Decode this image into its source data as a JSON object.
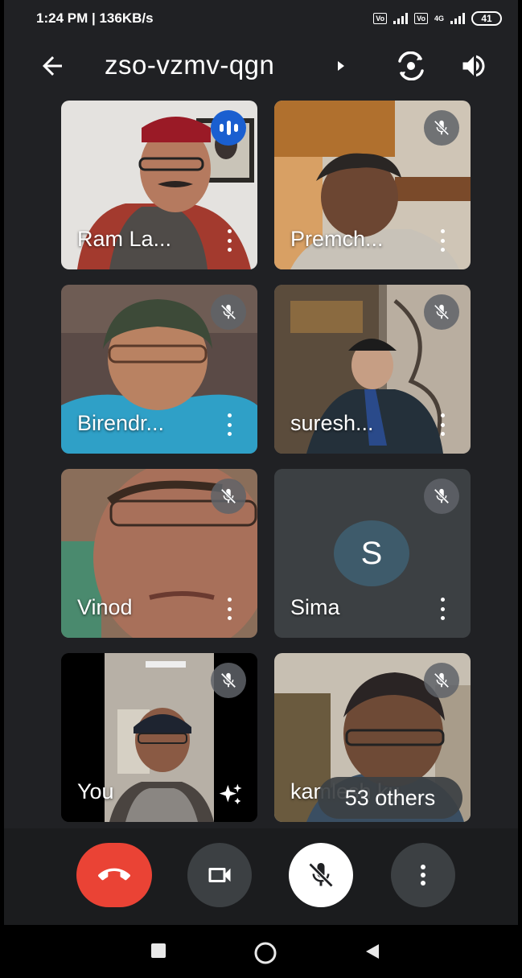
{
  "status_bar": {
    "time_speed": "1:24 PM | 136KB/s",
    "volte_label": "Vo LTE",
    "network_type": "4G",
    "battery": "41"
  },
  "header": {
    "meeting_code": "zso-vzmv-qgn"
  },
  "participants": [
    {
      "name": "Ram La...",
      "state": "speaking"
    },
    {
      "name": "Premch...",
      "state": "muted"
    },
    {
      "name": "Birendr...",
      "state": "muted"
    },
    {
      "name": "suresh...",
      "state": "muted"
    },
    {
      "name": "Vinod",
      "state": "muted"
    },
    {
      "name": "Sima",
      "state": "muted",
      "avatar_letter": "S"
    },
    {
      "name": "You",
      "state": "muted"
    },
    {
      "name": "kamlesh ku",
      "state": "muted"
    }
  ],
  "others_chip": "53 others",
  "colors": {
    "background": "#202124",
    "end_call": "#ea4335",
    "speaking": "#1a5fd0",
    "avatar": "#3e5b6b"
  },
  "icons": {
    "back": "back-arrow-icon",
    "switch_camera": "camera-switch-icon",
    "speaker": "speaker-icon",
    "end_call": "phone-hangup-icon",
    "camera": "video-camera-icon",
    "mic": "mic-off-icon",
    "more": "more-vert-icon"
  }
}
